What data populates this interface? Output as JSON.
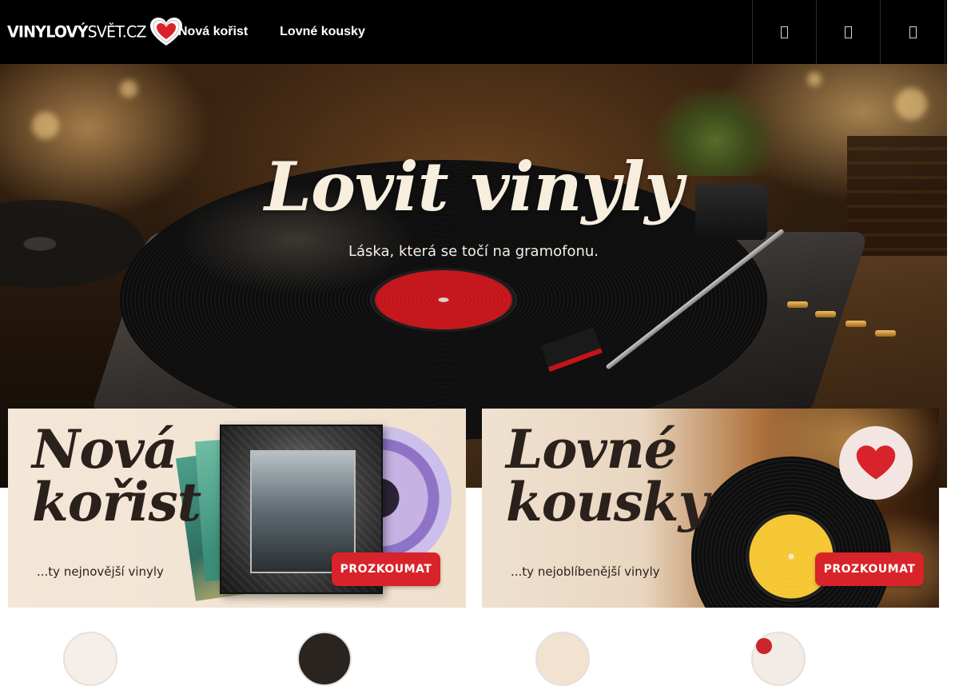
{
  "brand": {
    "logo_bold": "VINYLOVÝ",
    "logo_light": "SVĚT.CZ",
    "logo_icon": "heart-record-icon"
  },
  "nav": {
    "items": [
      {
        "label": "Nová kořist"
      },
      {
        "label": "Lovné kousky"
      }
    ]
  },
  "header_icons": [
    "search-icon",
    "user-icon",
    "cart-icon"
  ],
  "hero": {
    "title": "Lovit vinyly",
    "subtitle": "Láska, která se točí na gramofonu."
  },
  "promo_cards": [
    {
      "title_line1": "Nová",
      "title_line2": "kořist",
      "subtitle": "...ty nejnovější vinyly",
      "button": "PROZKOUMAT"
    },
    {
      "title_line1": "Lovné",
      "title_line2": "kousky",
      "subtitle": "...ty nejoblíbenější vinyly",
      "button": "PROZKOUMAT"
    }
  ],
  "colors": {
    "accent": "#d9232a",
    "header_bg": "#000000",
    "card_text": "#2b211c"
  }
}
